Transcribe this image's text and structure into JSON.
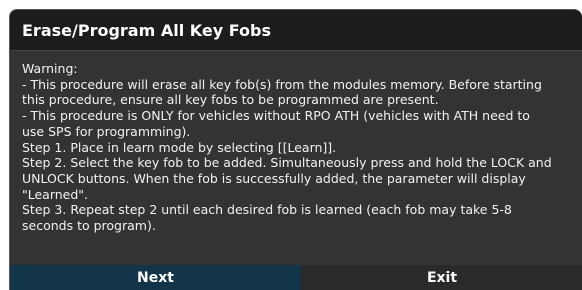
{
  "dialog": {
    "title": "Erase/Program All Key Fobs",
    "message_lines": [
      "Warning:",
      "- This procedure will erase all key fob(s) from the modules memory. Before starting",
      "this procedure, ensure all key fobs to be programmed are present.",
      "- This procedure is ONLY for vehicles without RPO ATH (vehicles with ATH need to",
      "use SPS for programming).",
      "Step 1. Place in learn mode by selecting [[Learn]].",
      "Step 2. Select the key fob to be added. Simultaneously press and hold the LOCK and",
      "UNLOCK buttons. When the fob is successfully added, the parameter will display",
      "\"Learned\".",
      "Step 3. Repeat step 2 until each desired fob is learned (each fob may take 5-8",
      "seconds to program)."
    ],
    "buttons": {
      "next_label": "Next",
      "exit_label": "Exit"
    }
  },
  "colors": {
    "title_bar": "#1c1c1c",
    "body": "#333333",
    "next_button": "#123549",
    "exit_button": "#2a2a2a",
    "text": "#ffffff"
  }
}
